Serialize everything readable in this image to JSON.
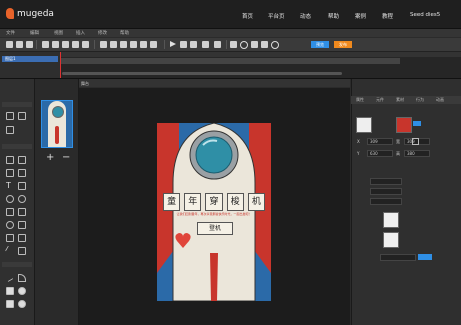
{
  "app": {
    "logo_text": "mugeda"
  },
  "nav": {
    "items": [
      "首页",
      "平台页",
      "动态",
      "帮助",
      "案例",
      "教程"
    ],
    "user": "Seed dies5"
  },
  "menubar": {
    "items": [
      "文件",
      "编辑",
      "视图",
      "插入",
      "修改",
      "帮助"
    ]
  },
  "toolbar": {
    "primary_label": "预览",
    "secondary_label": "发布"
  },
  "timeline": {
    "layer_name": "图层1"
  },
  "stage": {
    "tab_label": "舞台"
  },
  "canvas": {
    "title_chars": [
      "童",
      "年",
      "穿",
      "梭",
      "机"
    ],
    "subtitle": "让我们回到童年，再次享受那些快乐时光，一起出发吧！",
    "button_label": "登机"
  },
  "right_panel": {
    "tabs": [
      "属性",
      "元件",
      "素材",
      "行为",
      "动画"
    ],
    "fields": {
      "x_label": "X",
      "y_label": "Y",
      "w_label": "宽",
      "h_label": "高",
      "x": "309",
      "y": "630",
      "w": "309",
      "h": "380"
    }
  },
  "colors": {
    "accent_blue": "#2f8fe6",
    "accent_orange": "#f08a1e",
    "rocket_red": "#c8352c",
    "window_teal": "#2f8fa6"
  }
}
